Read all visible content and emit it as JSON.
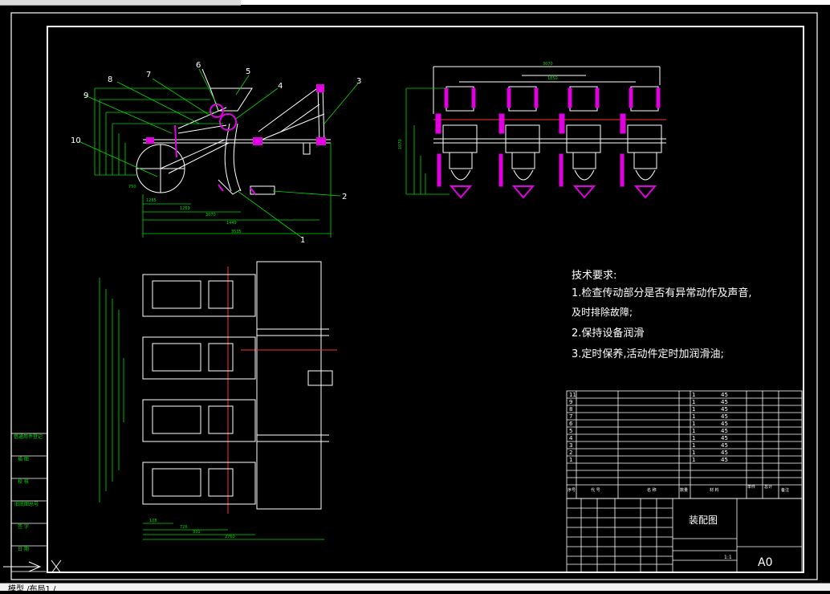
{
  "colors": {
    "background": "#000000",
    "line": "#ffffff",
    "accent": "#e000e0",
    "centerline": "#ff3030",
    "dimension": "#00ff00",
    "frame": "#ffffff"
  },
  "side_view": {
    "part_numbers": [
      "1",
      "2",
      "3",
      "4",
      "5",
      "6",
      "7",
      "8",
      "9",
      "10"
    ],
    "dimensions": {
      "d1": "1269",
      "d2": "3070",
      "d3": "1449",
      "d4": "3535",
      "d5": "1285",
      "d6": "750"
    }
  },
  "front_view": {
    "dimensions": {
      "top": "3070",
      "mid": "1850",
      "height": "1070"
    }
  },
  "top_view": {
    "dimensions": {
      "d1": "108",
      "d2": "726",
      "d3": "331",
      "d4": "2760"
    }
  },
  "technical_requirements": {
    "title": "技术要求:",
    "items": [
      "1.检查传动部分是否有异常动作及声音,",
      "及时排除故障;",
      "2.保持设备润滑",
      "3.定时保养,活动件定时加润滑油;"
    ]
  },
  "bom": {
    "rows": [
      {
        "no": "11",
        "qty": "1",
        "code": "45"
      },
      {
        "no": "9",
        "qty": "1",
        "code": "45"
      },
      {
        "no": "8",
        "qty": "1",
        "code": "45"
      },
      {
        "no": "7",
        "qty": "1",
        "code": "45"
      },
      {
        "no": "6",
        "qty": "1",
        "code": "45"
      },
      {
        "no": "5",
        "qty": "1",
        "code": "45"
      },
      {
        "no": "4",
        "qty": "1",
        "code": "45"
      },
      {
        "no": "3",
        "qty": "1",
        "code": "45"
      },
      {
        "no": "2",
        "qty": "1",
        "code": "45"
      },
      {
        "no": "1",
        "qty": "1",
        "code": "45"
      }
    ],
    "header": {
      "seq": "序号",
      "code": "代 号",
      "name": "名 称",
      "qty": "数量",
      "material": "材 料",
      "single": "单件",
      "total": "总计",
      "note": "备注"
    }
  },
  "title_block": {
    "drawing_name": "装配图",
    "sheet_size": "A0",
    "scale": "1:1"
  },
  "left_strip": {
    "labels": [
      "借通用件登记",
      "描 图",
      "校 核",
      "旧底图总号",
      "签 字",
      "日 期"
    ]
  },
  "status_bar": {
    "text": "模型 /布局1 /"
  }
}
